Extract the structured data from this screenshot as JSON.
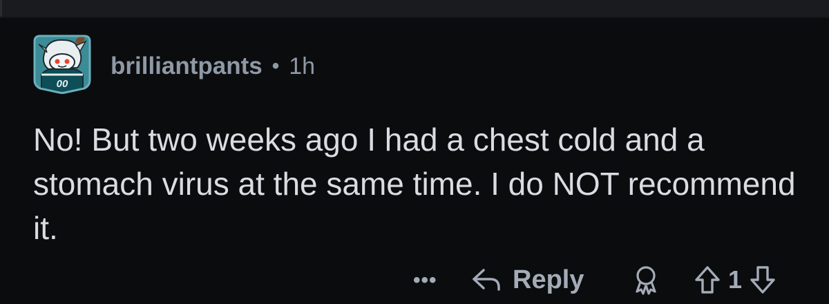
{
  "comment": {
    "author": "brilliantpants",
    "separator": "•",
    "age": "1h",
    "body": "No! But two weeks ago I had a chest cold and a stomach virus at the same time. I do NOT recommend it."
  },
  "avatar": {
    "icon": "reddit-snoo-eagles-avatar",
    "jersey_number": "00",
    "colors": {
      "frame": "#4a8fa0",
      "jersey": "#0e4e57",
      "background": "#2c7b85"
    }
  },
  "actions": {
    "more_label": "•••",
    "reply_label": "Reply",
    "reply_icon": "reply-arrow-icon",
    "award_icon": "award-icon",
    "upvote_icon": "upvote-arrow-icon",
    "downvote_icon": "downvote-arrow-icon",
    "score": "1"
  },
  "theme": {
    "background": "#0b0c0e",
    "text": "#d9dde2",
    "muted": "#8f99a5",
    "icon": "#a3acb6"
  }
}
